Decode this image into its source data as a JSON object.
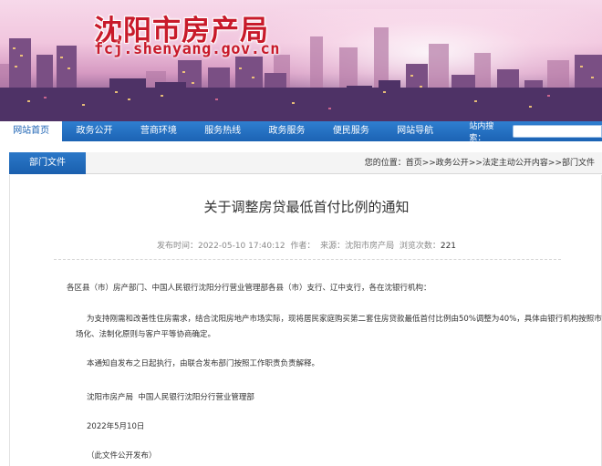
{
  "header": {
    "title": "沈阳市房产局",
    "url": "fcj.shenyang.gov.cn"
  },
  "nav": {
    "items": [
      "网站首页",
      "政务公开",
      "营商环境",
      "服务热线",
      "政务服务",
      "便民服务",
      "网站导航"
    ],
    "active_index": 0,
    "search_label": "站内搜索："
  },
  "section": {
    "tab_label": "部门文件",
    "breadcrumb": [
      "您的位置：",
      "首页",
      ">>政务公开",
      ">>法定主动公开内容",
      ">>部门文件"
    ]
  },
  "article": {
    "title": "关于调整房贷最低首付比例的通知",
    "meta": {
      "publish_label": "发布时间：",
      "publish_time": "2022-05-10 17:40:12",
      "author_label": "作者：",
      "source_label": "来源：",
      "source": "沈阳市房产局",
      "views_label": "浏览次数：",
      "views": "221"
    },
    "paragraphs": [
      "各区县（市）房产部门、中国人民银行沈阳分行营业管理部各县（市）支行、辽中支行，各在沈银行机构：",
      "为支持刚需和改善性住房需求，结合沈阳房地产市场实际，现将居民家庭购买第二套住房贷款最低首付比例由50%调整为40%，具体由银行机构按照市",
      "场化、法制化原则与客户平等协商确定。",
      "本通知自发布之日起执行，由联合发布部门按照工作职责负责解释。",
      "沈阳市房产局  中国人民银行沈阳分行营业管理部",
      "2022年5月10日",
      "（此文件公开发布）"
    ]
  },
  "colors": {
    "nav_blue": "#1c63b4",
    "title_red": "#c81a2a"
  }
}
